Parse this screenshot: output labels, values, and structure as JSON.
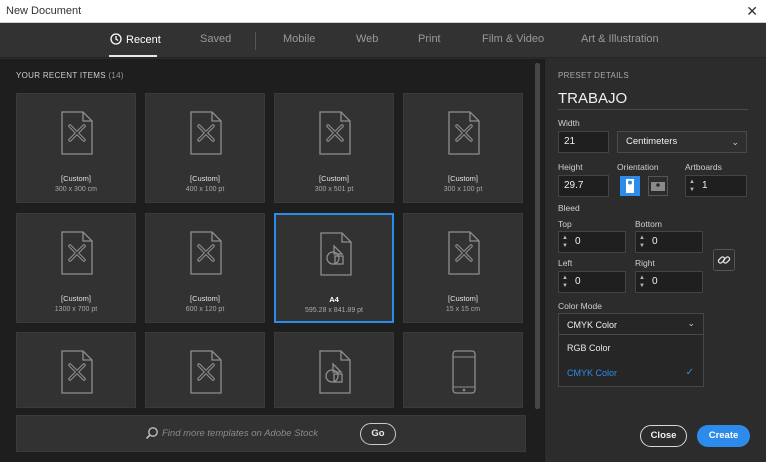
{
  "window": {
    "title": "New Document",
    "close_glyph": "✕"
  },
  "tabs": [
    {
      "label": "Recent",
      "active": true
    },
    {
      "label": "Saved"
    },
    {
      "label": "Mobile"
    },
    {
      "label": "Web"
    },
    {
      "label": "Print"
    },
    {
      "label": "Film & Video"
    },
    {
      "label": "Art & Illustration"
    }
  ],
  "recent": {
    "title": "YOUR RECENT ITEMS",
    "count": "(14)",
    "items": [
      {
        "name": "[Custom]",
        "size": "300 x 300 cm",
        "icon": "custom-doc-icon"
      },
      {
        "name": "[Custom]",
        "size": "400 x 100 pt",
        "icon": "custom-doc-icon"
      },
      {
        "name": "[Custom]",
        "size": "300 x 501 pt",
        "icon": "custom-doc-icon"
      },
      {
        "name": "[Custom]",
        "size": "300 x 100 pt",
        "icon": "custom-doc-icon"
      },
      {
        "name": "[Custom]",
        "size": "1300 x 700 pt",
        "icon": "custom-doc-icon"
      },
      {
        "name": "[Custom]",
        "size": "600 x 120 pt",
        "icon": "custom-doc-icon"
      },
      {
        "name": "A4",
        "size": "595.28 x 841.89 pt",
        "icon": "print-doc-icon",
        "selected": true
      },
      {
        "name": "[Custom]",
        "size": "15 x 15 cm",
        "icon": "custom-doc-icon"
      },
      {
        "name": "",
        "size": "",
        "icon": "custom-doc-icon"
      },
      {
        "name": "",
        "size": "",
        "icon": "custom-doc-icon"
      },
      {
        "name": "",
        "size": "",
        "icon": "print-doc-icon"
      },
      {
        "name": "",
        "size": "",
        "icon": "mobile-device-icon"
      }
    ]
  },
  "stock": {
    "placeholder": "Find more templates on Adobe Stock",
    "go_label": "Go"
  },
  "preset": {
    "title": "PRESET DETAILS",
    "doc_name": "TRABAJO",
    "width_label": "Width",
    "width_value": "21",
    "units": "Centimeters",
    "height_label": "Height",
    "height_value": "29.7",
    "orientation_label": "Orientation",
    "artboards_label": "Artboards",
    "artboards_value": "1",
    "bleed_label": "Bleed",
    "top_label": "Top",
    "top_value": "0",
    "bottom_label": "Bottom",
    "bottom_value": "0",
    "left_label": "Left",
    "left_value": "0",
    "right_label": "Right",
    "right_value": "0",
    "color_mode_label": "Color Mode",
    "color_mode_value": "CMYK Color",
    "color_mode_options": [
      "RGB Color",
      "CMYK Color"
    ],
    "check_glyph": "✓"
  },
  "buttons": {
    "close": "Close",
    "create": "Create"
  },
  "colors": {
    "accent": "#2d8ceb"
  }
}
